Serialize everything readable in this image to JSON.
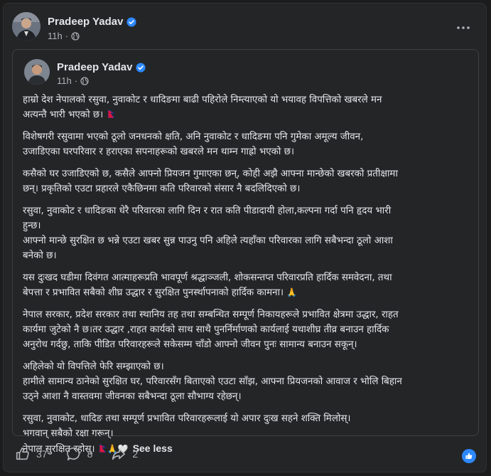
{
  "outer_post": {
    "author": "Pradeep Yadav",
    "time": "11h",
    "more_icon": "ellipsis-icon"
  },
  "shared_post": {
    "author": "Pradeep Yadav",
    "time": "11h",
    "paragraphs": [
      [
        "हाम्रो देश नेपालको रसुवा, नुवाकोट र धादिङमा बाढी पहिरोले निम्त्याएको यो भयावह विपत्तिको खबरले मन",
        "अत्यन्तै भारी भएको छ।"
      ],
      [
        "विशेषगरी रसुवामा भएको ठूलो जनधनको क्षति, अनि नुवाकोट र धादिङमा पनि गुमेका अमूल्य जीवन,",
        "उजाडिएका घरपरिवार र हराएका सपनाहरूको खबरले मन थाम्न गाह्रो भएको छ।"
      ],
      [
        "कसैको घर उजाडिएको छ, कसैले आफ्नो प्रियजन गुमाएका छन्, कोही अझै आफ्ना मान्छेको खबरको प्रतीक्षामा",
        "छन्। प्रकृतिको एउटा प्रहारले एकैछिनमा कति परिवारको संसार नै बदलिदिएको छ।"
      ],
      [
        "रसुवा, नुवाकोट र धादिङका धेरै परिवारका लागि दिन र रात कति पीडादायी होला,कल्पना गर्दा पनि हृदय भारी",
        "हुन्छ।",
        "आफ्नो मान्छे सुरक्षित छ भन्ने एउटा खबर सुन्न पाउनु पनि अहिले त्यहाँका परिवारका लागि सबैभन्दा ठूलो आशा",
        "बनेको छ।"
      ],
      [
        "यस दुःखद घडीमा दिवंगत आत्माहरूप्रति भावपूर्ण श्रद्धाञ्जली, शोकसन्तप्त परिवारप्रति हार्दिक समवेदना, तथा",
        "बेपत्ता र प्रभावित सबैको शीघ्र उद्धार र सुरक्षित पुनर्स्थापनाको हार्दिक कामना।"
      ],
      [
        "नेपाल सरकार, प्रदेश सरकार तथा स्थानिय तह तथा सम्बन्धित सम्पूर्ण निकायहरूले प्रभावित क्षेत्रमा उद्धार, राहत",
        "कार्यमा जुटेको नै छ।तर उद्धार ,राहत कार्यको साथ साथै पुनर्निर्माणको कार्यलाई यथाशीघ्र तीव्र बनाउन हार्दिक",
        "अनुरोध गर्दछु, ताकि पीडित परिवारहरूले सकेसम्म चाँडो आफ्नो जीवन पुनः सामान्य बनाउन सकून्।"
      ],
      [
        "अहिलेको यो विपत्तिले फेरि सम्झाएको छ।",
        "हामीले सामान्य ठानेको सुरक्षित घर, परिवारसँग बिताएको एउटा साँझ, आफ्ना प्रियजनको आवाज र भोलि बिहान",
        "उठ्ने आशा नै वास्तवमा जीवनका सबैभन्दा ठूला सौभाग्य रहेछन्।"
      ],
      [
        "रसुवा, नुवाकोट, धादिङ तथा सम्पूर्ण प्रभावित परिवारहरूलाई यो अपार दुःख सहने शक्ति मिलोस्।",
        "भगवान् सबैको रक्षा गरून्।",
        "नेपाल सुरक्षित रहोस्।"
      ]
    ],
    "see_less": "See less"
  },
  "reactions": {
    "likes": "37",
    "comments": "8",
    "shares": "2"
  },
  "colors": {
    "background": "#242526",
    "text": "#e4e6eb",
    "muted": "#b0b3b8",
    "accent": "#2d88ff"
  }
}
